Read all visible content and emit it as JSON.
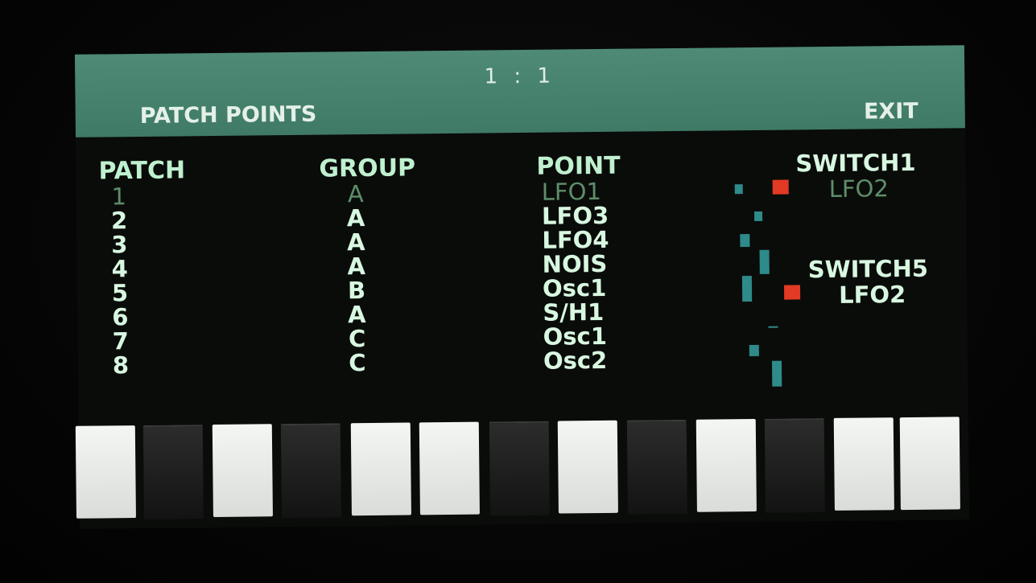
{
  "header": {
    "position": "1 : 1",
    "title": "PATCH POINTS",
    "exit_label": "EXIT"
  },
  "columns": {
    "patch": "PATCH",
    "group": "GROUP",
    "point": "POINT"
  },
  "rows": [
    {
      "patch": "1",
      "group": "A",
      "point": "LFO1",
      "dim": true
    },
    {
      "patch": "2",
      "group": "A",
      "point": "LFO3"
    },
    {
      "patch": "3",
      "group": "A",
      "point": "LFO4"
    },
    {
      "patch": "4",
      "group": "A",
      "point": "NOIS"
    },
    {
      "patch": "5",
      "group": "B",
      "point": "Osc1"
    },
    {
      "patch": "6",
      "group": "A",
      "point": "S/H1"
    },
    {
      "patch": "7",
      "group": "C",
      "point": "Osc1"
    },
    {
      "patch": "8",
      "group": "C",
      "point": "Osc2"
    }
  ],
  "switches": [
    {
      "name": "SWITCH1",
      "target": "LFO2"
    },
    {
      "name": "SWITCH5",
      "target": "LFO2"
    }
  ],
  "keys": [
    "white",
    "black",
    "white",
    "black",
    "white",
    "white",
    "black",
    "white",
    "black",
    "white",
    "black",
    "white",
    "white"
  ],
  "colors": {
    "header": "#4a8672",
    "text": "#d8f7e0",
    "meter": "#2f8a8a",
    "switch_active": "#e23a24"
  }
}
